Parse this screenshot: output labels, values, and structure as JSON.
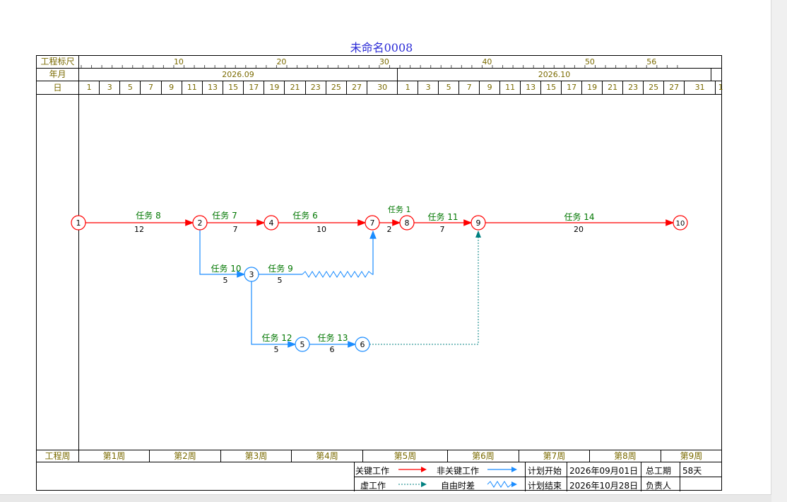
{
  "title": "未命名0008",
  "header": {
    "ruler_label": "工程标尺",
    "ruler_marks": [
      "10",
      "20",
      "30",
      "40",
      "50",
      "56"
    ],
    "month_label": "年月",
    "months": [
      "2026.09",
      "2026.10"
    ],
    "day_label": "日",
    "days_sep": [
      "1",
      "3",
      "5",
      "7",
      "9",
      "11",
      "13",
      "15",
      "17",
      "19",
      "21",
      "23",
      "25",
      "27",
      "30"
    ],
    "days_oct": [
      "1",
      "3",
      "5",
      "7",
      "9",
      "11",
      "13",
      "15",
      "17",
      "19",
      "21",
      "23",
      "25",
      "27",
      "31",
      "1"
    ],
    "week_label": "工程周",
    "weeks": [
      "第1周",
      "第2周",
      "第3周",
      "第4周",
      "第5周",
      "第6周",
      "第7周",
      "第8周",
      "第9周"
    ]
  },
  "nodes": [
    "1",
    "2",
    "3",
    "4",
    "5",
    "6",
    "7",
    "8",
    "9",
    "10"
  ],
  "tasks": [
    {
      "name": "任务 8",
      "duration": "12"
    },
    {
      "name": "任务 7",
      "duration": "7"
    },
    {
      "name": "任务 6",
      "duration": "10"
    },
    {
      "name": "任务 1",
      "duration": "2"
    },
    {
      "name": "任务 11",
      "duration": "7"
    },
    {
      "name": "任务 14",
      "duration": "20"
    },
    {
      "name": "任务 10",
      "duration": "5"
    },
    {
      "name": "任务 9",
      "duration": "5"
    },
    {
      "name": "任务 12",
      "duration": "5"
    },
    {
      "name": "任务 13",
      "duration": "6"
    }
  ],
  "legend": {
    "critical": "关键工作",
    "noncritical": "非关键工作",
    "dummy": "虚工作",
    "free_float": "自由时差",
    "plan_start_label": "计划开始",
    "plan_start": "2026年09月01日",
    "plan_end_label": "计划结束",
    "plan_end": "2026年10月28日",
    "total_label": "总工期",
    "total": "58天",
    "owner_label": "负责人",
    "owner": ""
  },
  "colors": {
    "critical": "#ff0000",
    "noncritical": "#1a8cff",
    "dummy": "#008080",
    "task_text": "#007700",
    "header_text": "#7a6a00",
    "title": "#2b2bd6"
  }
}
